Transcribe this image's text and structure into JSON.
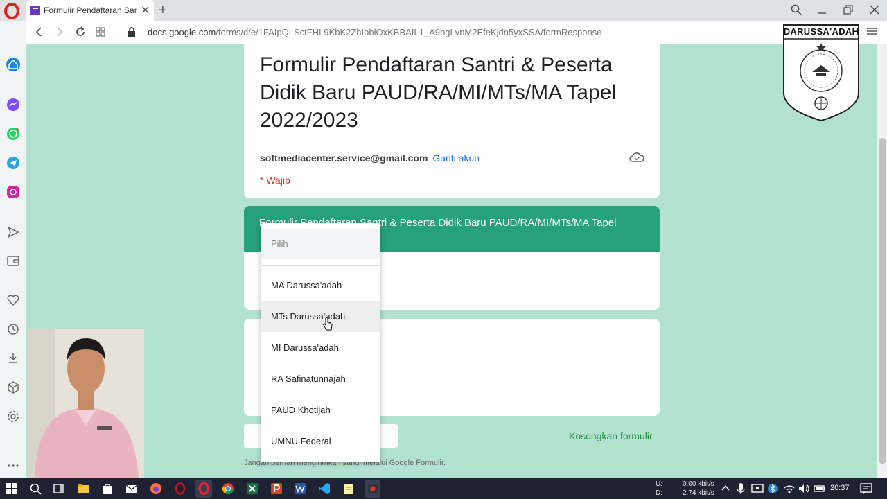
{
  "browser": {
    "tab_title": "Formulir Pendaftaran Santri",
    "url_prefix": "docs.google.com",
    "url_path": "/forms/d/e/1FAIpQLSctFHL9KbK2ZhIoblOxKBBAIL1_A9bgLvnM2EfeKjdn5yxSSA/formResponse",
    "tab_close_glyph": "✕",
    "new_tab_glyph": "+"
  },
  "logo": {
    "text": "DARUSSA'ADAH"
  },
  "form": {
    "title": "Formulir Pendaftaran Santri & Peserta Didik Baru PAUD/RA/MI/MTs/MA Tapel 2022/2023",
    "account_email": "softmediacenter.service@gmail.com",
    "switch_account": "Ganti akun",
    "required_note": "* Wajib",
    "section_title": "Formulir Pendaftaran Santri & Peserta Didik Baru PAUD/RA/MI/MTs/MA Tapel",
    "clear_form": "Kosongkan formulir",
    "footer_note": "Jangan pernah mengirimkan sandi melalui Google Formulir."
  },
  "dropdown": {
    "placeholder": "Pilih",
    "options": [
      "MA Darussa'adah",
      "MTs Darussa'adah",
      "MI Darussa'adah",
      "RA Safinatunnajah",
      "PAUD Khotijah",
      "UMNU Federal"
    ],
    "hovered_option": "MTs Darussa'adah"
  },
  "taskbar": {
    "net_up_label": "U:",
    "net_down_label": "D:",
    "net_up": "0.00 kbit/s",
    "net_down": "2.74 kbit/s",
    "time": "20:37"
  },
  "colors": {
    "page_bg": "#b4e2d0",
    "section_header": "#26a17b",
    "link_blue": "#1a73e8",
    "required_red": "#d93025",
    "clear_green": "#1e8e3e"
  }
}
